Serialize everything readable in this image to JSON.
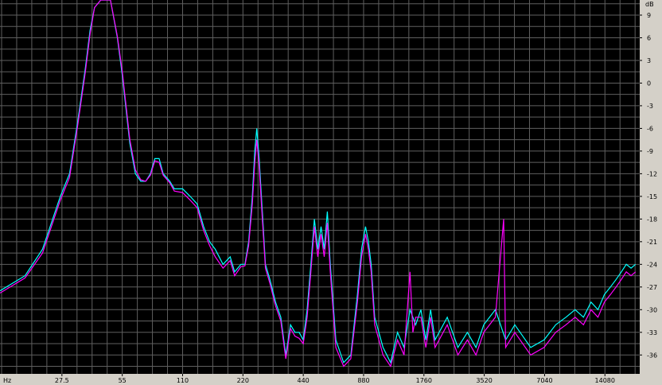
{
  "chart_data": {
    "type": "line",
    "title": "",
    "xlabel": "Hz",
    "ylabel": "dB",
    "x_scale": "log",
    "xlim": [
      13.5,
      21000
    ],
    "ylim": [
      -38.5,
      11
    ],
    "grid": true,
    "x_tick_labels": [
      {
        "value": 27.5,
        "label": "27.5"
      },
      {
        "value": 55,
        "label": "55"
      },
      {
        "value": 110,
        "label": "110"
      },
      {
        "value": 220,
        "label": "220"
      },
      {
        "value": 440,
        "label": "440"
      },
      {
        "value": 880,
        "label": "880"
      },
      {
        "value": 1760,
        "label": "1760"
      },
      {
        "value": 3520,
        "label": "3520"
      },
      {
        "value": 7040,
        "label": "7040"
      },
      {
        "value": 14080,
        "label": "14080"
      }
    ],
    "y_ticks": [
      9,
      6,
      3,
      0,
      -3,
      -6,
      -9,
      -12,
      -15,
      -18,
      -21,
      -24,
      -27,
      -30,
      -33,
      -36
    ],
    "colors": {
      "background": "#000000",
      "grid": "#5f5f5f",
      "series_a": "#00ffff",
      "series_b": "#ff00ff",
      "frame": "#d4d0c8"
    },
    "series": [
      {
        "values": [
          [
            13.5,
            -27.5
          ],
          [
            18,
            -25.5
          ],
          [
            22,
            -22
          ],
          [
            27,
            -15
          ],
          [
            30,
            -12
          ],
          [
            33,
            -5
          ],
          [
            36,
            2
          ],
          [
            38,
            7
          ],
          [
            40,
            10
          ],
          [
            43,
            11
          ],
          [
            48,
            11
          ],
          [
            52,
            6
          ],
          [
            55,
            1
          ],
          [
            60,
            -8
          ],
          [
            64,
            -12
          ],
          [
            68,
            -13
          ],
          [
            72,
            -13
          ],
          [
            76,
            -12
          ],
          [
            80,
            -10
          ],
          [
            84,
            -10
          ],
          [
            88,
            -12
          ],
          [
            95,
            -13
          ],
          [
            100,
            -14
          ],
          [
            110,
            -14
          ],
          [
            120,
            -15
          ],
          [
            130,
            -16
          ],
          [
            140,
            -19
          ],
          [
            150,
            -21
          ],
          [
            160,
            -22
          ],
          [
            175,
            -24
          ],
          [
            190,
            -23
          ],
          [
            200,
            -25
          ],
          [
            215,
            -24
          ],
          [
            225,
            -24
          ],
          [
            235,
            -21
          ],
          [
            245,
            -15
          ],
          [
            252,
            -9
          ],
          [
            258,
            -6
          ],
          [
            265,
            -10
          ],
          [
            275,
            -17
          ],
          [
            285,
            -24
          ],
          [
            300,
            -26
          ],
          [
            320,
            -29
          ],
          [
            340,
            -31
          ],
          [
            360,
            -36
          ],
          [
            380,
            -32
          ],
          [
            400,
            -33
          ],
          [
            420,
            -33
          ],
          [
            440,
            -34
          ],
          [
            460,
            -30
          ],
          [
            480,
            -24
          ],
          [
            500,
            -18
          ],
          [
            520,
            -22
          ],
          [
            540,
            -19
          ],
          [
            560,
            -22
          ],
          [
            580,
            -17
          ],
          [
            600,
            -24
          ],
          [
            640,
            -34
          ],
          [
            700,
            -37
          ],
          [
            760,
            -36
          ],
          [
            820,
            -28
          ],
          [
            860,
            -22
          ],
          [
            900,
            -19
          ],
          [
            930,
            -21
          ],
          [
            960,
            -24
          ],
          [
            1000,
            -31
          ],
          [
            1100,
            -35
          ],
          [
            1200,
            -37
          ],
          [
            1300,
            -33
          ],
          [
            1400,
            -35
          ],
          [
            1500,
            -30
          ],
          [
            1600,
            -32
          ],
          [
            1700,
            -30
          ],
          [
            1800,
            -34
          ],
          [
            1900,
            -30
          ],
          [
            2000,
            -34
          ],
          [
            2300,
            -31
          ],
          [
            2600,
            -35
          ],
          [
            2900,
            -33
          ],
          [
            3200,
            -35
          ],
          [
            3500,
            -32
          ],
          [
            4000,
            -30
          ],
          [
            4500,
            -34
          ],
          [
            5000,
            -32
          ],
          [
            6000,
            -35
          ],
          [
            7000,
            -34
          ],
          [
            8000,
            -32
          ],
          [
            9000,
            -31
          ],
          [
            10000,
            -30
          ],
          [
            11000,
            -31
          ],
          [
            12000,
            -29
          ],
          [
            13000,
            -30
          ],
          [
            14000,
            -28
          ],
          [
            15000,
            -27
          ],
          [
            16000,
            -26
          ],
          [
            17000,
            -25
          ],
          [
            18000,
            -24
          ],
          [
            19000,
            -24.5
          ],
          [
            20000,
            -24
          ]
        ]
      },
      {
        "values": [
          [
            13.5,
            -27.8
          ],
          [
            18,
            -25.8
          ],
          [
            22,
            -22.5
          ],
          [
            27,
            -15.5
          ],
          [
            30,
            -12.5
          ],
          [
            33,
            -5.5
          ],
          [
            36,
            1.5
          ],
          [
            38,
            6.5
          ],
          [
            40,
            10
          ],
          [
            43,
            11
          ],
          [
            48,
            11
          ],
          [
            52,
            6.2
          ],
          [
            55,
            1.5
          ],
          [
            60,
            -7.5
          ],
          [
            64,
            -11.5
          ],
          [
            68,
            -12.8
          ],
          [
            72,
            -13
          ],
          [
            76,
            -12.2
          ],
          [
            80,
            -10.3
          ],
          [
            84,
            -10.5
          ],
          [
            88,
            -12.2
          ],
          [
            95,
            -13.2
          ],
          [
            100,
            -14.3
          ],
          [
            110,
            -14.5
          ],
          [
            120,
            -15.5
          ],
          [
            130,
            -16.5
          ],
          [
            140,
            -19.5
          ],
          [
            150,
            -21.5
          ],
          [
            160,
            -23
          ],
          [
            175,
            -24.5
          ],
          [
            190,
            -23.5
          ],
          [
            200,
            -25.5
          ],
          [
            215,
            -24.3
          ],
          [
            225,
            -24.2
          ],
          [
            235,
            -21.5
          ],
          [
            245,
            -16
          ],
          [
            252,
            -10.5
          ],
          [
            258,
            -7.5
          ],
          [
            265,
            -11
          ],
          [
            275,
            -18
          ],
          [
            285,
            -24.5
          ],
          [
            300,
            -26.5
          ],
          [
            320,
            -29.5
          ],
          [
            340,
            -31.5
          ],
          [
            360,
            -36.5
          ],
          [
            380,
            -32.5
          ],
          [
            400,
            -33.5
          ],
          [
            420,
            -33.8
          ],
          [
            440,
            -34.5
          ],
          [
            460,
            -31
          ],
          [
            480,
            -25
          ],
          [
            500,
            -19
          ],
          [
            520,
            -23
          ],
          [
            540,
            -20
          ],
          [
            560,
            -23
          ],
          [
            580,
            -18.5
          ],
          [
            600,
            -25
          ],
          [
            640,
            -35
          ],
          [
            700,
            -37.5
          ],
          [
            760,
            -36.5
          ],
          [
            820,
            -29
          ],
          [
            860,
            -23
          ],
          [
            900,
            -20
          ],
          [
            930,
            -22
          ],
          [
            960,
            -25
          ],
          [
            1000,
            -32
          ],
          [
            1100,
            -36
          ],
          [
            1200,
            -37.5
          ],
          [
            1300,
            -34
          ],
          [
            1400,
            -36
          ],
          [
            1500,
            -25
          ],
          [
            1550,
            -33
          ],
          [
            1600,
            -31
          ],
          [
            1700,
            -31
          ],
          [
            1800,
            -35
          ],
          [
            1900,
            -31
          ],
          [
            2000,
            -35
          ],
          [
            2300,
            -32
          ],
          [
            2600,
            -36
          ],
          [
            2900,
            -34
          ],
          [
            3200,
            -36
          ],
          [
            3500,
            -33
          ],
          [
            4000,
            -31
          ],
          [
            4400,
            -18
          ],
          [
            4500,
            -35
          ],
          [
            5000,
            -33
          ],
          [
            6000,
            -36
          ],
          [
            7000,
            -35
          ],
          [
            8000,
            -33
          ],
          [
            9000,
            -32
          ],
          [
            10000,
            -31
          ],
          [
            11000,
            -32
          ],
          [
            12000,
            -30
          ],
          [
            13000,
            -31
          ],
          [
            14000,
            -29
          ],
          [
            15000,
            -28
          ],
          [
            16000,
            -27
          ],
          [
            17000,
            -26
          ],
          [
            18000,
            -25
          ],
          [
            19000,
            -25.5
          ],
          [
            20000,
            -25
          ]
        ]
      }
    ]
  }
}
